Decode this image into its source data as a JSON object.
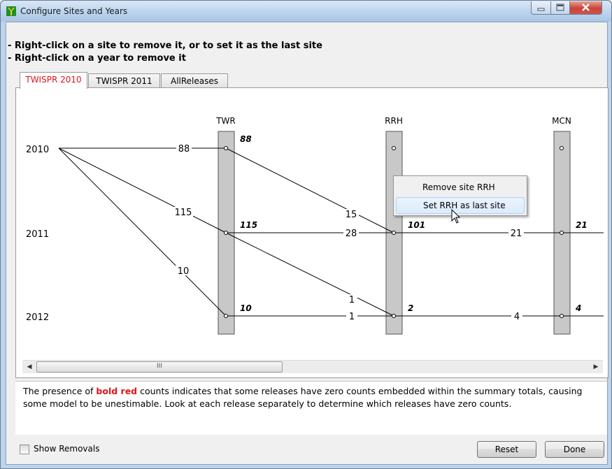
{
  "window": {
    "title": "Configure Sites and Years"
  },
  "instructions": [
    "- Right-click on a site to remove it, or to set it as the last site",
    "- Right-click on a year to remove it"
  ],
  "tabs": [
    {
      "label": "TWISPR 2010",
      "active": true
    },
    {
      "label": "TWISPR 2011",
      "active": false
    },
    {
      "label": "AllReleases",
      "active": false
    }
  ],
  "graph": {
    "sites": [
      "TWR",
      "RRH",
      "MCN"
    ],
    "years": [
      "2010",
      "2011",
      "2012"
    ],
    "site_totals": {
      "TWR": [
        "88",
        "115",
        "10"
      ],
      "RRH": [
        "101",
        "2"
      ],
      "MCN": [
        "21",
        "4"
      ]
    },
    "flows": {
      "y2010_TWR": "88",
      "y2010_2011": "115",
      "y2010_2012": "10",
      "TWR_2010_RRH_2011": "15",
      "TWR_2011_RRH_2011": "28",
      "TWR_2011_RRH_2012": "1",
      "TWR_2012_RRH_2012": "1",
      "RRH_2011_MCN_2011": "21",
      "RRH_2012_MCN_2012": "4"
    }
  },
  "context_menu": {
    "items": [
      {
        "label": "Remove site RRH",
        "highlighted": false
      },
      {
        "label": "Set RRH as last site",
        "highlighted": true
      }
    ]
  },
  "scrollbar": {
    "grip": "III"
  },
  "message": {
    "before": "The presence of ",
    "emphasis": "bold red",
    "after": " counts indicates that some releases have zero counts embedded within the summary totals, causing some model to be unestimable. Look at each release separately to determine which releases have zero counts."
  },
  "footer": {
    "show_removals_label": "Show Removals",
    "show_removals_checked": false,
    "reset_label": "Reset",
    "done_label": "Done"
  },
  "colors": {
    "accent_red": "#e2141a",
    "site_bar": "#c8c8c8"
  }
}
